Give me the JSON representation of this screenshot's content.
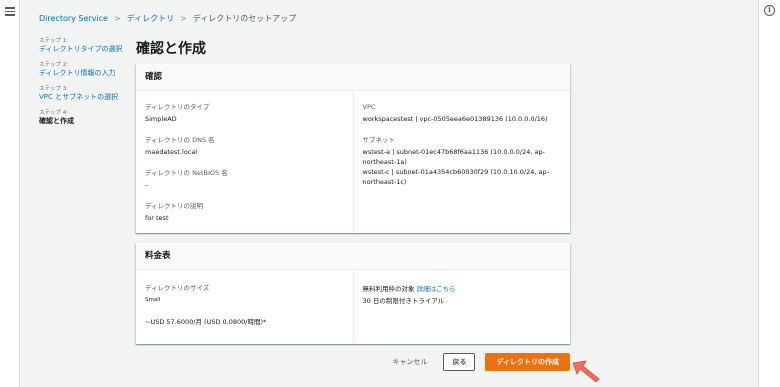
{
  "breadcrumb": {
    "items": [
      "Directory Service",
      "ディレクトリ",
      "ディレクトリのセットアップ"
    ],
    "separator": ">"
  },
  "steps": [
    {
      "num": "ステップ 1:",
      "label": "ディレクトリタイプの選択"
    },
    {
      "num": "ステップ 2:",
      "label": "ディレクトリ情報の入力"
    },
    {
      "num": "ステップ 3:",
      "label": "VPC とサブネットの選択"
    },
    {
      "num": "ステップ 4:",
      "label": "確認と作成"
    }
  ],
  "page_title": "確認と作成",
  "review": {
    "header": "確認",
    "left": [
      {
        "label": "ディレクトリのタイプ",
        "value": "SimpleAD"
      },
      {
        "label": "ディレクトリの DNS 名",
        "value": "maedatest.local"
      },
      {
        "label": "ディレクトリの NetBIOS 名",
        "value": "–"
      },
      {
        "label": "ディレクトリの説明",
        "value": "for test"
      }
    ],
    "vpc_label": "VPC",
    "vpc_value": "workspacestest | vpc-0505eea6e01389136 (10.0.0.0/16)",
    "subnet_label": "サブネット",
    "subnets": [
      "wstest-a | subnet-01ec47b68f6aa1136 (10.0.0.0/24, ap-northeast-1a)",
      "wstest-c | subnet-01a4354cb60030f29 (10.0.10.0/24, ap-northeast-1c)"
    ]
  },
  "pricing": {
    "header": "料金表",
    "size_label": "ディレクトリのサイズ",
    "size_value": "Small",
    "price": "~USD 57.6000/月 (USD 0.0800/時間)*",
    "free_tier_text": "無料利用枠の対象",
    "free_tier_link": "詳細はこちら",
    "trial": "30 日の制限付きトライアル"
  },
  "actions": {
    "cancel": "キャンセル",
    "back": "戻る",
    "create": "ディレクトリの作成"
  },
  "colors": {
    "link": "#0073bb",
    "primary": "#ec7211",
    "background": "#f2f3f3",
    "annotation_arrow": "#f46c5e"
  },
  "icons": {
    "menu": "hamburger-menu-icon",
    "info": "info-icon",
    "annotation": "red-arrow-icon"
  }
}
